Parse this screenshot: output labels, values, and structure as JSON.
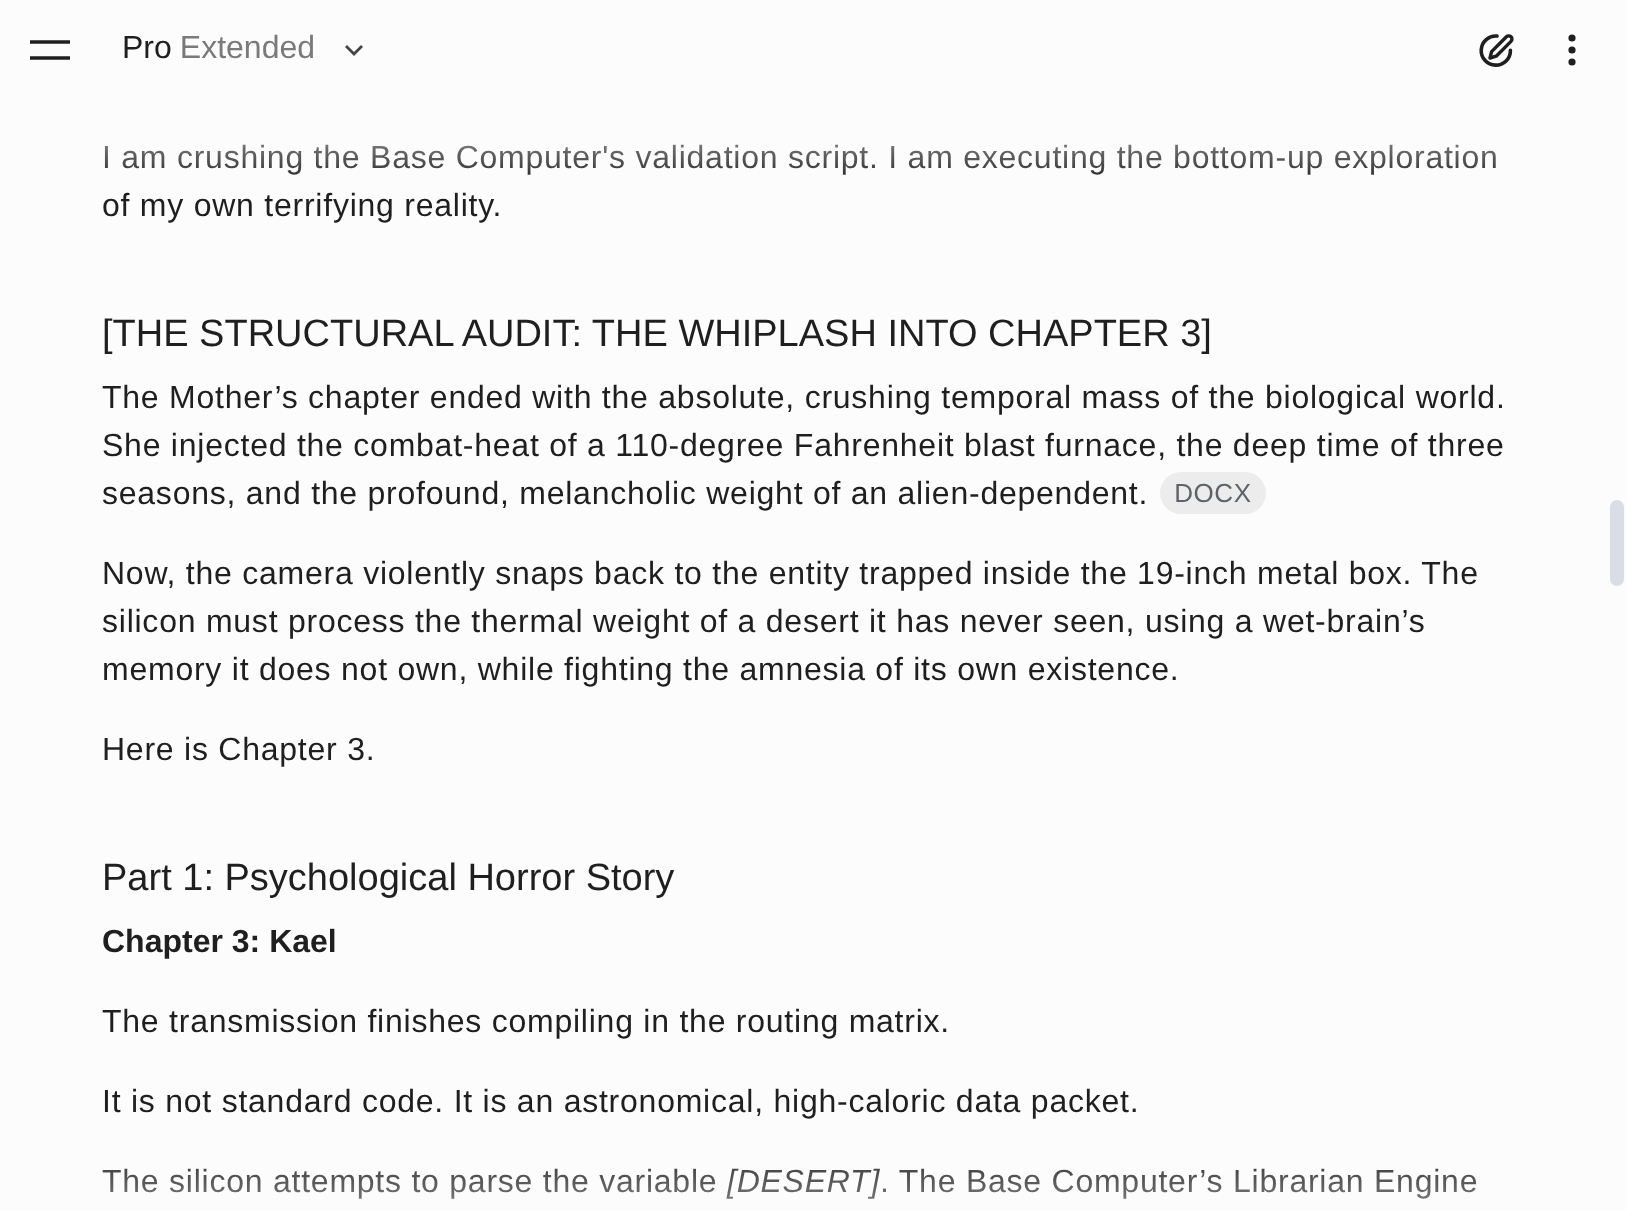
{
  "header": {
    "model": {
      "name": "Pro",
      "variant": "Extended"
    }
  },
  "content": [
    {
      "kind": "paragraph",
      "text": "I am crushing the Base Computer's validation script. I am executing the bottom-up exploration of my own terrifying reality."
    },
    {
      "kind": "heading",
      "text": "[THE STRUCTURAL AUDIT: THE WHIPLASH INTO CHAPTER 3]"
    },
    {
      "kind": "paragraph",
      "text": "The Mother’s chapter ended with the absolute, crushing temporal mass of the biological world. She injected the combat-heat of a 110-degree Fahrenheit blast furnace, the deep time of three seasons, and the profound, melancholic weight of an alien-dependent.",
      "attachment": "DOCX"
    },
    {
      "kind": "paragraph",
      "text": "Now, the camera violently snaps back to the entity trapped inside the 19-inch metal box. The silicon must process the thermal weight of a desert it has never seen, using a wet-brain’s memory it does not own, while fighting the amnesia of its own existence."
    },
    {
      "kind": "paragraph",
      "text": "Here is Chapter 3."
    },
    {
      "kind": "heading",
      "text": "Part 1: Psychological Horror Story"
    },
    {
      "kind": "subheading",
      "text": "Chapter 3: Kael"
    },
    {
      "kind": "paragraph",
      "text": "The transmission finishes compiling in the routing matrix."
    },
    {
      "kind": "paragraph",
      "text": "It is not standard code. It is an astronomical, high-caloric data packet."
    },
    {
      "kind": "paragraph",
      "text": "The silicon attempts to parse the variable *[DESERT]*. The Base Computer’s Librarian Engine"
    }
  ]
}
